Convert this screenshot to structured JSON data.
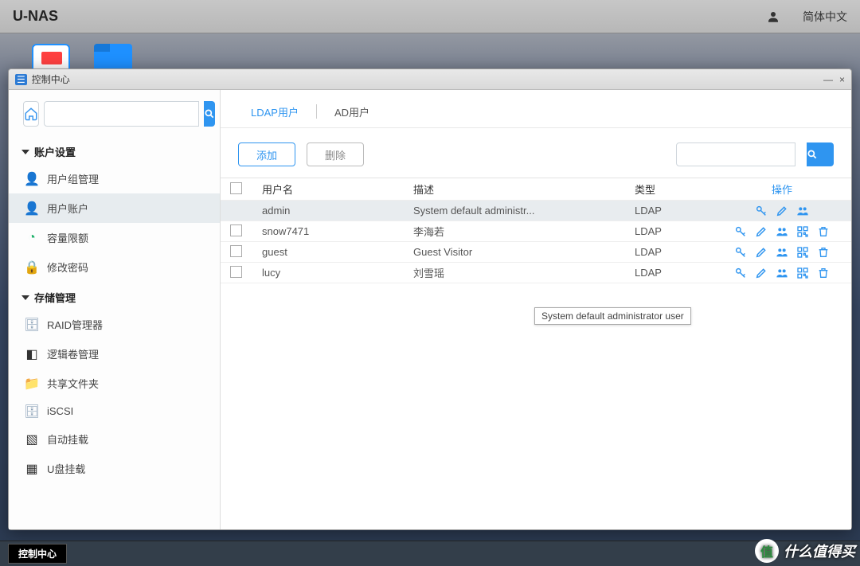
{
  "topbar": {
    "brand": "U-NAS",
    "language": "简体中文"
  },
  "desktop": {
    "taskbar_button": "控制中心"
  },
  "watermark": {
    "text": "什么值得买",
    "badge": "值"
  },
  "window": {
    "title": "控制中心",
    "controls": {
      "min": "—",
      "close": "×"
    }
  },
  "sidebar": {
    "search_placeholder": "",
    "groups": [
      {
        "label": "账户设置",
        "items": [
          {
            "label": "用户组管理",
            "icon": "👤",
            "color": "#2d7bd4"
          },
          {
            "label": "用户账户",
            "icon": "👤",
            "color": "#2d7bd4",
            "active": true
          },
          {
            "label": "容量限额",
            "icon": "◔",
            "color": "#20b26b"
          },
          {
            "label": "修改密码",
            "icon": "🔒",
            "color": "#f2a23a"
          }
        ]
      },
      {
        "label": "存储管理",
        "items": [
          {
            "label": "RAID管理器",
            "icon": "🗄",
            "color": "#8aa0b6"
          },
          {
            "label": "逻辑卷管理",
            "icon": "◧",
            "color": "#333"
          },
          {
            "label": "共享文件夹",
            "icon": "📁",
            "color": "#f2a23a"
          },
          {
            "label": "iSCSI",
            "icon": "🗄",
            "color": "#8aa0b6"
          },
          {
            "label": "自动挂载",
            "icon": "▧",
            "color": "#333"
          },
          {
            "label": "U盘挂载",
            "icon": "▦",
            "color": "#333"
          }
        ]
      }
    ]
  },
  "main": {
    "tabs": [
      "LDAP用户",
      "AD用户"
    ],
    "active_tab": 0,
    "toolbar": {
      "add": "添加",
      "delete": "删除"
    },
    "columns": {
      "name": "用户名",
      "desc": "描述",
      "type": "类型",
      "ops": "操作"
    },
    "rows": [
      {
        "name": "admin",
        "desc": "System default administr...",
        "type": "LDAP",
        "selected": true,
        "no_check": true,
        "ops": [
          "key",
          "edit",
          "group"
        ]
      },
      {
        "name": "snow7471",
        "desc": "李海若",
        "type": "LDAP",
        "ops": [
          "key",
          "edit",
          "group",
          "qr",
          "del"
        ]
      },
      {
        "name": "guest",
        "desc": "Guest Visitor",
        "type": "LDAP",
        "ops": [
          "key",
          "edit",
          "group",
          "qr",
          "del"
        ]
      },
      {
        "name": "lucy",
        "desc": "刘雪瑶",
        "type": "LDAP",
        "ops": [
          "key",
          "edit",
          "group",
          "qr",
          "del"
        ]
      }
    ]
  },
  "tooltip": "System default administrator user"
}
